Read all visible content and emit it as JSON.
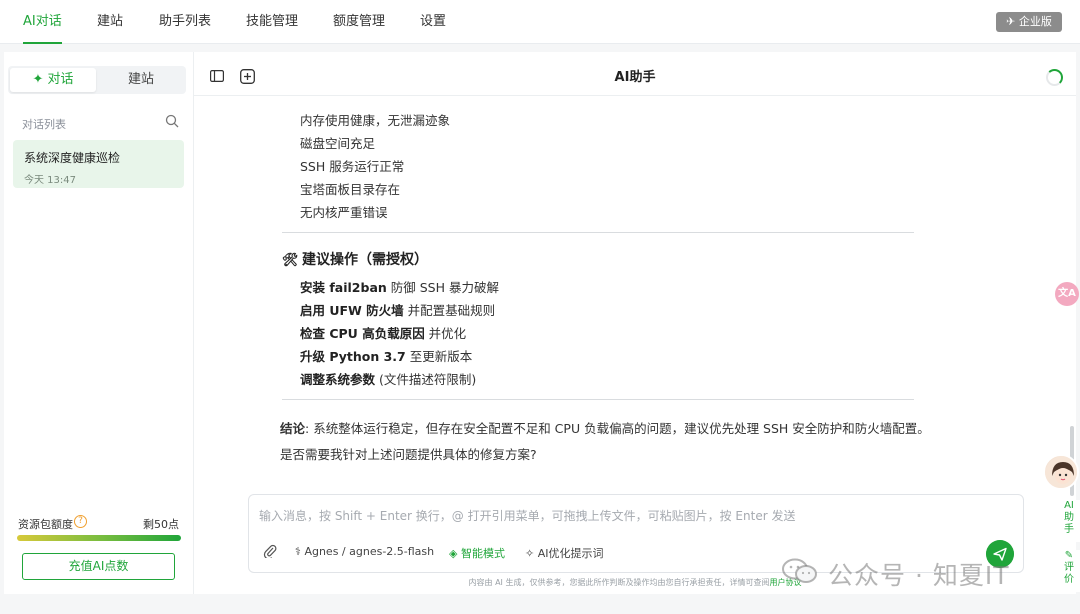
{
  "topnav": {
    "tabs": [
      {
        "label": "AI对话",
        "active": true
      },
      {
        "label": "建站",
        "active": false
      },
      {
        "label": "助手列表",
        "active": false
      },
      {
        "label": "技能管理",
        "active": false
      },
      {
        "label": "额度管理",
        "active": false
      },
      {
        "label": "设置",
        "active": false
      }
    ],
    "badge": "企业版"
  },
  "sidebar": {
    "segments": [
      "对话",
      "建站"
    ],
    "list_label": "对话列表",
    "conversations": [
      {
        "title": "系统深度健康巡检",
        "time": "今天 13:47"
      }
    ],
    "quota": {
      "label": "资源包额度",
      "remaining": "剩50点",
      "fill": 1.0
    },
    "recharge_label": "充值AI点数"
  },
  "chat": {
    "title": "AI助手",
    "status_items": [
      "内存使用健康，无泄漏迹象",
      "磁盘空间充足",
      "SSH 服务运行正常",
      "宝塔面板目录存在",
      "无内核严重错误"
    ],
    "section_heading": "建议操作（需授权）",
    "actions": [
      {
        "bold": "安装 fail2ban",
        "rest": " 防御 SSH 暴力破解"
      },
      {
        "bold": "启用 UFW 防火墙",
        "rest": " 并配置基础规则"
      },
      {
        "bold": "检查 CPU 高负载原因",
        "rest": " 并优化"
      },
      {
        "bold": "升级 Python 3.7",
        "rest": " 至更新版本"
      },
      {
        "bold": "调整系统参数",
        "rest": " (文件描述符限制)"
      }
    ],
    "conclusion_label": "结论",
    "conclusion_text": ": 系统整体运行稳定，但存在安全配置不足和 CPU 负载偏高的问题，建议优先处理 SSH 安全防护和防火墙配置。",
    "question": "是否需要我针对上述问题提供具体的修复方案?"
  },
  "input": {
    "placeholder": "输入消息，按 Shift + Enter 换行，@ 打开引用菜单，可拖拽上传文件，可粘贴图片，按 Enter 发送",
    "model": "Agnes / agnes-2.5-flash",
    "smart_mode": "智能模式",
    "optimize": "AI优化提示词",
    "disclaimer": "内容由 AI 生成，仅供参考，您据此所作判断及操作均由您自行承担责任，详情可查阅",
    "disclaimer_link": "用户协议"
  },
  "right": {
    "ai_tab": "AI助手",
    "review_tab": "评价"
  },
  "watermark": "公众号 · 知夏IT",
  "colors": {
    "accent": "#20a53a"
  }
}
